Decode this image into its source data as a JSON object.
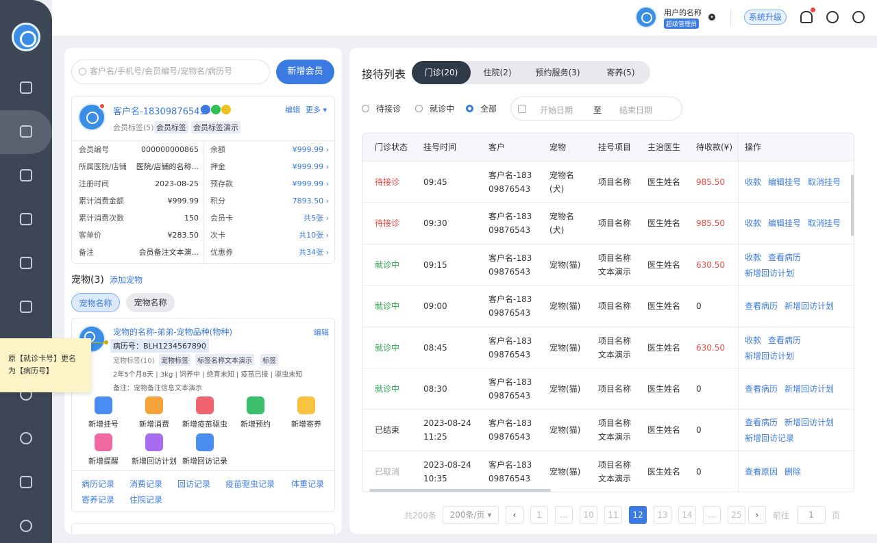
{
  "topbar": {
    "user_name": "用户的名称",
    "user_role": "超级管理员",
    "upgrade_label": "系统升级"
  },
  "search": {
    "placeholder": "客户名/手机号/会员编号/宠物名/病历号"
  },
  "add_member_label": "新增会员",
  "customer": {
    "name": "客户名-18309876543",
    "edit_label": "编辑",
    "more_label": "更多 ▾",
    "tag_label": "会员标签(5)",
    "tags": [
      "会员标签",
      "会员标签演示"
    ],
    "info_left": [
      {
        "k": "会员编号",
        "v": "000000000865"
      },
      {
        "k": "所属医院/店铺",
        "v": "医院/店铺的名称..."
      },
      {
        "k": "注册时间",
        "v": "2023-08-25"
      },
      {
        "k": "累计消费金额",
        "v": "¥999.99"
      },
      {
        "k": "累计消费次数",
        "v": "150"
      },
      {
        "k": "客单价",
        "v": "¥283.50"
      },
      {
        "k": "备注",
        "v": "会员备注文本演..."
      }
    ],
    "info_right": [
      {
        "k": "余额",
        "v": "¥999.99 ›"
      },
      {
        "k": "押金",
        "v": "¥999.99 ›"
      },
      {
        "k": "预存款",
        "v": "¥999.99 ›"
      },
      {
        "k": "积分",
        "v": "7893.50 ›"
      },
      {
        "k": "会员卡",
        "v": "共5张 ›"
      },
      {
        "k": "次卡",
        "v": "共10张 ›"
      },
      {
        "k": "优惠券",
        "v": "共34张 ›"
      }
    ]
  },
  "pets": {
    "header": "宠物(3)",
    "add_label": "添加宠物",
    "tabs": [
      "宠物名称",
      "宠物名称"
    ],
    "card": {
      "name": "宠物的名称-弟弟-宠物品种(物种)",
      "edit_label": "编辑",
      "record_no": "病历号：BLH1234567890",
      "tag_label": "宠物标签(10)",
      "tags": [
        "宠物标签",
        "标签名称文本演示",
        "标签"
      ],
      "info": "2年5个月8天 | 3kg | 饲养中 | 绝育未知 | 疫苗已接 | 驱虫未知",
      "note": "备注：宠物备注信息文本演示",
      "actions": [
        {
          "label": "新增挂号",
          "color": "#4a8df0"
        },
        {
          "label": "新增消费",
          "color": "#f5a23a"
        },
        {
          "label": "新增疫苗驱虫",
          "color": "#f06470"
        },
        {
          "label": "新增预约",
          "color": "#3cbf6a"
        },
        {
          "label": "新增寄养",
          "color": "#f7c341"
        },
        {
          "label": "新增提醒",
          "color": "#ef6aa0"
        },
        {
          "label": "新增回访计划",
          "color": "#a86cf0"
        },
        {
          "label": "新增回访记录",
          "color": "#4a8df0"
        }
      ],
      "records": [
        "病历记录",
        "消费记录",
        "回访记录",
        "疫苗驱虫记录",
        "体重记录",
        "寄养记录",
        "住院记录"
      ]
    }
  },
  "tooltip": {
    "line1": "原【就诊卡号】更名",
    "line2": "为【病历号】"
  },
  "reception": {
    "title": "接待列表",
    "tabs": [
      "门诊(20)",
      "住院(2)",
      "预约服务(3)",
      "寄养(5)"
    ],
    "filters": [
      "待接诊",
      "就诊中",
      "全部"
    ],
    "date_start": "开始日期",
    "date_to": "至",
    "date_end": "结束日期",
    "columns": [
      "门诊状态",
      "挂号时间",
      "客户",
      "宠物",
      "挂号项目",
      "主治医生",
      "待收款(¥)",
      "操作"
    ],
    "rows": [
      {
        "status": "待接诊",
        "status_color": "#f0483e",
        "time1": "09:45",
        "time2": "",
        "cust1": "客户名-183",
        "cust2": "09876543",
        "pet1": "宠物名",
        "pet2": "(犬)",
        "item1": "项目名称",
        "item2": "",
        "doctor": "医生姓名",
        "amount": "985.50",
        "amount_color": "#f0483e",
        "ops": [
          [
            "收款",
            "编辑挂号",
            "取消挂号"
          ]
        ]
      },
      {
        "status": "待接诊",
        "status_color": "#f0483e",
        "time1": "09:30",
        "time2": "",
        "cust1": "客户名-183",
        "cust2": "09876543",
        "pet1": "宠物名",
        "pet2": "(犬)",
        "item1": "项目名称",
        "item2": "",
        "doctor": "医生姓名",
        "amount": "985.50",
        "amount_color": "#f0483e",
        "ops": [
          [
            "收款",
            "编辑挂号",
            "取消挂号"
          ]
        ]
      },
      {
        "status": "就诊中",
        "status_color": "#2aa24e",
        "time1": "09:15",
        "time2": "",
        "cust1": "客户名-183",
        "cust2": "09876543",
        "pet1": "宠物(猫)",
        "pet2": "",
        "item1": "项目名称",
        "item2": "文本演示",
        "doctor": "医生姓名",
        "amount": "630.50",
        "amount_color": "#f0483e",
        "ops": [
          [
            "收款",
            "查看病历"
          ],
          [
            "新增回访计划"
          ]
        ]
      },
      {
        "status": "就诊中",
        "status_color": "#2aa24e",
        "time1": "09:00",
        "time2": "",
        "cust1": "客户名-183",
        "cust2": "09876543",
        "pet1": "宠物(猫)",
        "pet2": "",
        "item1": "项目名称",
        "item2": "",
        "doctor": "医生姓名",
        "amount": "0",
        "amount_color": "#333333",
        "ops": [
          [
            "查看病历",
            "新增回访计划"
          ]
        ]
      },
      {
        "status": "就诊中",
        "status_color": "#2aa24e",
        "time1": "08:45",
        "time2": "",
        "cust1": "客户名-183",
        "cust2": "09876543",
        "pet1": "宠物(猫)",
        "pet2": "",
        "item1": "项目名称",
        "item2": "文本演示",
        "doctor": "医生姓名",
        "amount": "630.50",
        "amount_color": "#f0483e",
        "ops": [
          [
            "收款",
            "查看病历"
          ],
          [
            "新增回访计划"
          ]
        ]
      },
      {
        "status": "就诊中",
        "status_color": "#2aa24e",
        "time1": "08:30",
        "time2": "",
        "cust1": "客户名-183",
        "cust2": "09876543",
        "pet1": "宠物(猫)",
        "pet2": "",
        "item1": "项目名称",
        "item2": "",
        "doctor": "医生姓名",
        "amount": "0",
        "amount_color": "#333333",
        "ops": [
          [
            "查看病历",
            "新增回访计划"
          ]
        ]
      },
      {
        "status": "已结束",
        "status_color": "#333333",
        "time1": "2023-08-24",
        "time2": "11:25",
        "cust1": "客户名-183",
        "cust2": "09876543",
        "pet1": "宠物(猫)",
        "pet2": "",
        "item1": "项目名称",
        "item2": "文本演示",
        "doctor": "医生姓名",
        "amount": "0",
        "amount_color": "#333333",
        "ops": [
          [
            "查看病历",
            "新增回访计划"
          ],
          [
            "新增回访记录"
          ]
        ]
      },
      {
        "status": "已取消",
        "status_color": "#aaaaaa",
        "time1": "2023-08-24",
        "time2": "10:35",
        "cust1": "客户名-183",
        "cust2": "09876543",
        "pet1": "宠物(猫)",
        "pet2": "",
        "item1": "项目名称",
        "item2": "文本演示",
        "doctor": "医生姓名",
        "amount": "0",
        "amount_color": "#333333",
        "ops": [
          [
            "查看原因",
            "删除"
          ]
        ]
      }
    ]
  },
  "pager": {
    "total": "共200条",
    "size": "200条/页 ▾",
    "pages": [
      "1",
      "...",
      "10",
      "11",
      "12",
      "13",
      "14",
      "...",
      "25"
    ],
    "current": "12",
    "goto_label": "前往",
    "goto_value": "1",
    "page_suffix": "页"
  }
}
